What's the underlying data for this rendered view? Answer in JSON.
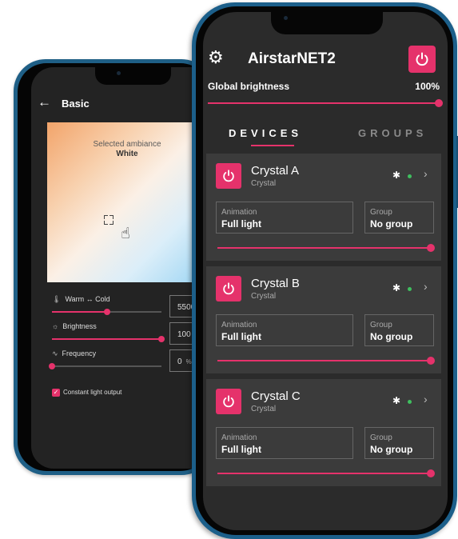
{
  "back_phone": {
    "title": "Basic",
    "back_icon": "arrow-left-icon",
    "home_icon": "home-icon",
    "ambiance": {
      "label": "Selected ambiance",
      "value": "White"
    },
    "sliders": [
      {
        "icon": "thermometer-icon",
        "label": "Warm ↔ Cold",
        "value": "5500 K",
        "unit": "",
        "level": 0.5
      },
      {
        "icon": "sun-icon",
        "label": "Brightness",
        "value": "100",
        "unit": "%",
        "level": 1.0
      },
      {
        "icon": "wave-icon",
        "label": "Frequency",
        "value": "0",
        "unit": "%",
        "level": 0.0
      }
    ],
    "checkbox": {
      "label": "Constant light output",
      "checked": true
    }
  },
  "front_phone": {
    "app_title": "AirstarNET2",
    "settings_icon": "gear-icon",
    "power_icon": "power-icon",
    "global_brightness": {
      "label": "Global brightness",
      "value": "100%",
      "level": 1.0
    },
    "tabs": [
      {
        "label": "DEVICES",
        "active": true
      },
      {
        "label": "GROUPS",
        "active": false
      }
    ],
    "devices": [
      {
        "name": "Crystal A",
        "type": "Crystal",
        "animation_label": "Animation",
        "animation": "Full light",
        "group_label": "Group",
        "group": "No group",
        "brightness": 1.0,
        "status": "connected"
      },
      {
        "name": "Crystal B",
        "type": "Crystal",
        "animation_label": "Animation",
        "animation": "Full light",
        "group_label": "Group",
        "group": "No group",
        "brightness": 1.0,
        "status": "connected"
      },
      {
        "name": "Crystal C",
        "type": "Crystal",
        "animation_label": "Animation",
        "animation": "Full light",
        "group_label": "Group",
        "group": "No group",
        "brightness": 1.0,
        "status": "connected"
      }
    ]
  },
  "colors": {
    "accent": "#e5326b",
    "online": "#3fbf5f",
    "frame": "#1c5f8a",
    "card": "#3b3b3b",
    "background": "#2b2b2b"
  }
}
